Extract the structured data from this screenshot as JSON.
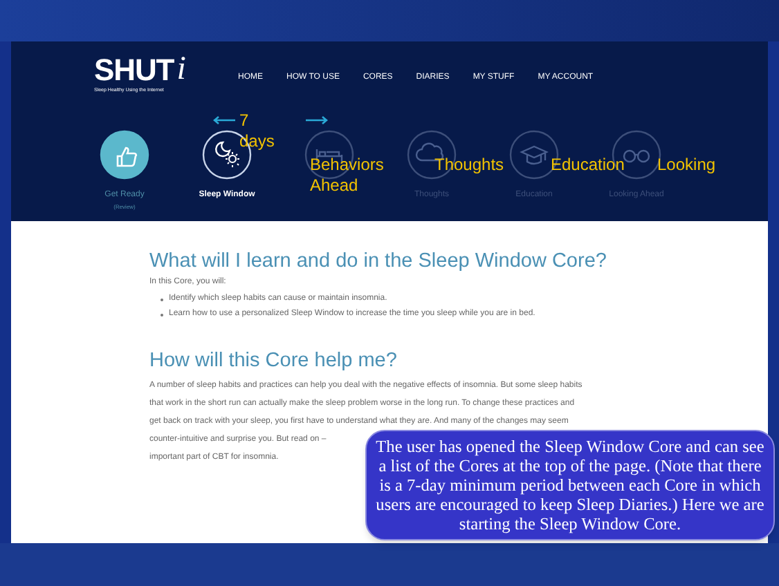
{
  "logo": {
    "name": "SHUT",
    "mark": "i",
    "tagline": "Sleep Healthy Using the Internet"
  },
  "nav": [
    {
      "label": "HOME"
    },
    {
      "label": "HOW TO USE"
    },
    {
      "label": "CORES"
    },
    {
      "label": "DIARIES"
    },
    {
      "label": "MY STUFF"
    },
    {
      "label": "MY ACCOUNT"
    }
  ],
  "cores": [
    {
      "label": "Get Ready",
      "sublabel": "(Review)",
      "completed": true,
      "selected": false
    },
    {
      "label": "Sleep Window",
      "completed": false,
      "selected": true
    },
    {
      "completed": false,
      "selected": false
    },
    {
      "label": "Thoughts",
      "completed": false,
      "selected": false
    },
    {
      "label": "Education",
      "completed": false,
      "selected": false
    },
    {
      "label": "Looking Ahead",
      "completed": false,
      "selected": false
    }
  ],
  "annotations": {
    "interval": [
      "7",
      "days"
    ],
    "labels": [
      "Behaviors Ahead",
      "Thoughts",
      "Education",
      "Looking"
    ]
  },
  "content": {
    "heading": "What will I learn and do in the Sleep Window Core?",
    "intro": "In this Core, you will:",
    "bullets": [
      "Identify which sleep habits can cause or maintain insomnia.",
      "Learn how to use a personalized Sleep Window to increase the time you sleep while you are in bed."
    ],
    "heading_2": "How will this Core help me?",
    "paragraph_lines": [
      "A number of sleep habits and practices can help you deal with the negative effects of insomnia. But some sleep habits",
      "that work in the short run can actually make the sleep problem worse in the long run. To change these practices and",
      "get back on track with your sleep, you first have to understand what they are. And many of the changes may seem",
      "counter-intuitive and surprise you. But read on –",
      "important part of CBT for insomnia."
    ]
  },
  "callout": "The user has opened the Sleep Window Core and can see a list of the Cores at the top of the page. (Note that there is a 7-day minimum period between each Core in which users are encouraged to keep Sleep Diaries.) Here we are starting the Sleep Window Core."
}
